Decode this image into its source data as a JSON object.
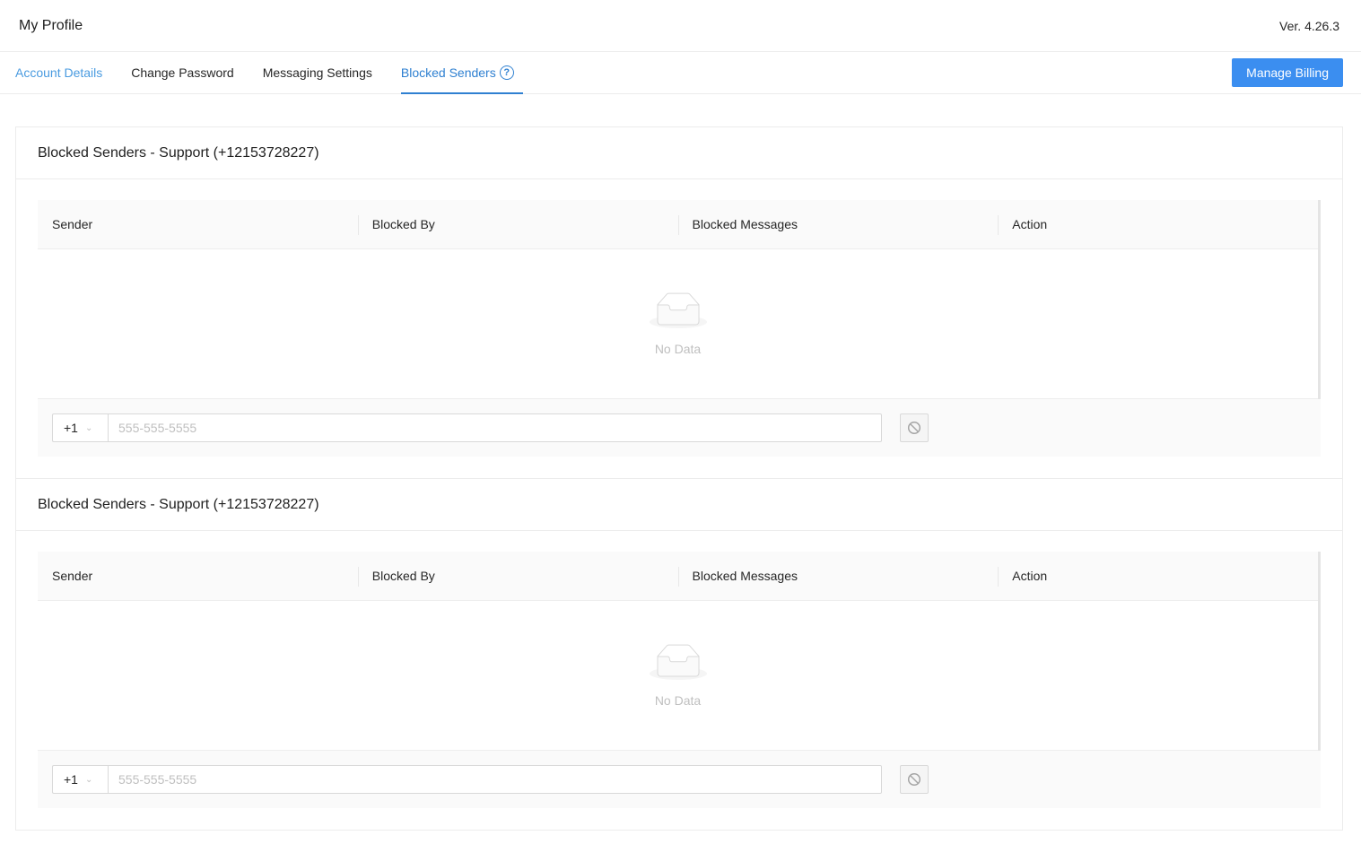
{
  "header": {
    "title": "My Profile",
    "version": "Ver. 4.26.3"
  },
  "tabs": [
    {
      "label": "Account Details"
    },
    {
      "label": "Change Password"
    },
    {
      "label": "Messaging Settings"
    },
    {
      "label": "Blocked Senders"
    }
  ],
  "billing_button": "Manage Billing",
  "colors": {
    "accent": "#2f80d1",
    "button": "#3b8ef0"
  },
  "sections": [
    {
      "title": "Blocked Senders - Support (+12153728227)",
      "columns": [
        "Sender",
        "Blocked By",
        "Blocked Messages",
        "Action"
      ],
      "empty_text": "No Data",
      "country_code": "+1",
      "phone_placeholder": "555-555-5555"
    },
    {
      "title": "Blocked Senders - Support (+12153728227)",
      "columns": [
        "Sender",
        "Blocked By",
        "Blocked Messages",
        "Action"
      ],
      "empty_text": "No Data",
      "country_code": "+1",
      "phone_placeholder": "555-555-5555"
    }
  ]
}
